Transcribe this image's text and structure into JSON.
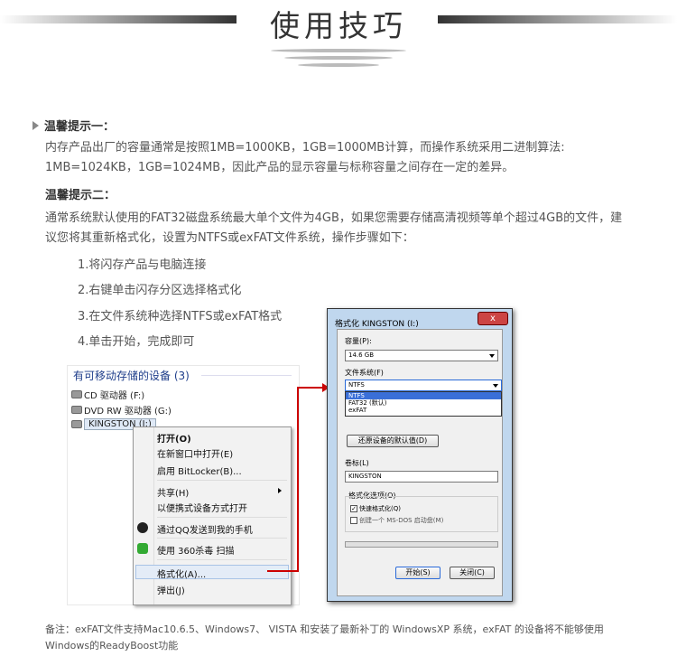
{
  "header": {
    "title": "使用技巧"
  },
  "tip1": {
    "heading": "温馨提示一：",
    "line1": "内存产品出厂的容量通常是按照1MB=1000KB，1GB=1000MB计算，而操作系统采用二进制算法:",
    "line2": "1MB=1024KB，1GB=1024MB，因此产品的显示容量与标称容量之间存在一定的差异。"
  },
  "tip2": {
    "heading": "温馨提示二：",
    "line1": "通常系统默认使用的FAT32磁盘系统最大单个文件为4GB，如果您需要存储高清视频等单个超过4GB的文件，建",
    "line2": "议您将其重新格式化，设置为NTFS或exFAT文件系统，操作步骤如下："
  },
  "steps": [
    "1.将闪存产品与电脑连接",
    "2.右键单击闪存分区选择格式化",
    "3.在文件系统种选择NTFS或exFAT格式",
    "4.单击开始，完成即可"
  ],
  "explorer": {
    "heading": "有可移动存储的设备 (3)",
    "drives": [
      "CD 驱动器 (F:)",
      "DVD RW 驱动器 (G:)",
      "KINGSTON (I:)"
    ]
  },
  "context_menu": {
    "items": [
      "打开(O)",
      "在新窗口中打开(E)",
      "启用 BitLocker(B)...",
      "共享(H)",
      "以便携式设备方式打开",
      "通过QQ发送到我的手机",
      "使用 360杀毒 扫描",
      "格式化(A)...",
      "弹出(J)"
    ]
  },
  "dialog": {
    "title": "格式化 KINGSTON (I:)",
    "capacity_label": "容量(P):",
    "capacity_value": "14.6 GB",
    "fs_label": "文件系统(F)",
    "fs_value": "NTFS",
    "fs_options": [
      "NTFS",
      "FAT32 (默认)",
      "exFAT"
    ],
    "restore_button": "还原设备的默认值(D)",
    "volume_label": "卷标(L)",
    "volume_value": "KINGSTON",
    "options_label": "格式化选项(O)",
    "quick_format": "快速格式化(Q)",
    "msdos": "创建一个 MS-DOS 启动盘(M)",
    "start_button": "开始(S)",
    "close_button": "关闭(C)",
    "close_x": "x"
  },
  "note": {
    "line1": "备注：exFAT文件支持Mac10.6.5、Windows7、 VISTA 和安装了最新补丁的 WindowsXP 系统，exFAT 的设备将不能够使用",
    "line2": "Windows的ReadyBoost功能"
  }
}
